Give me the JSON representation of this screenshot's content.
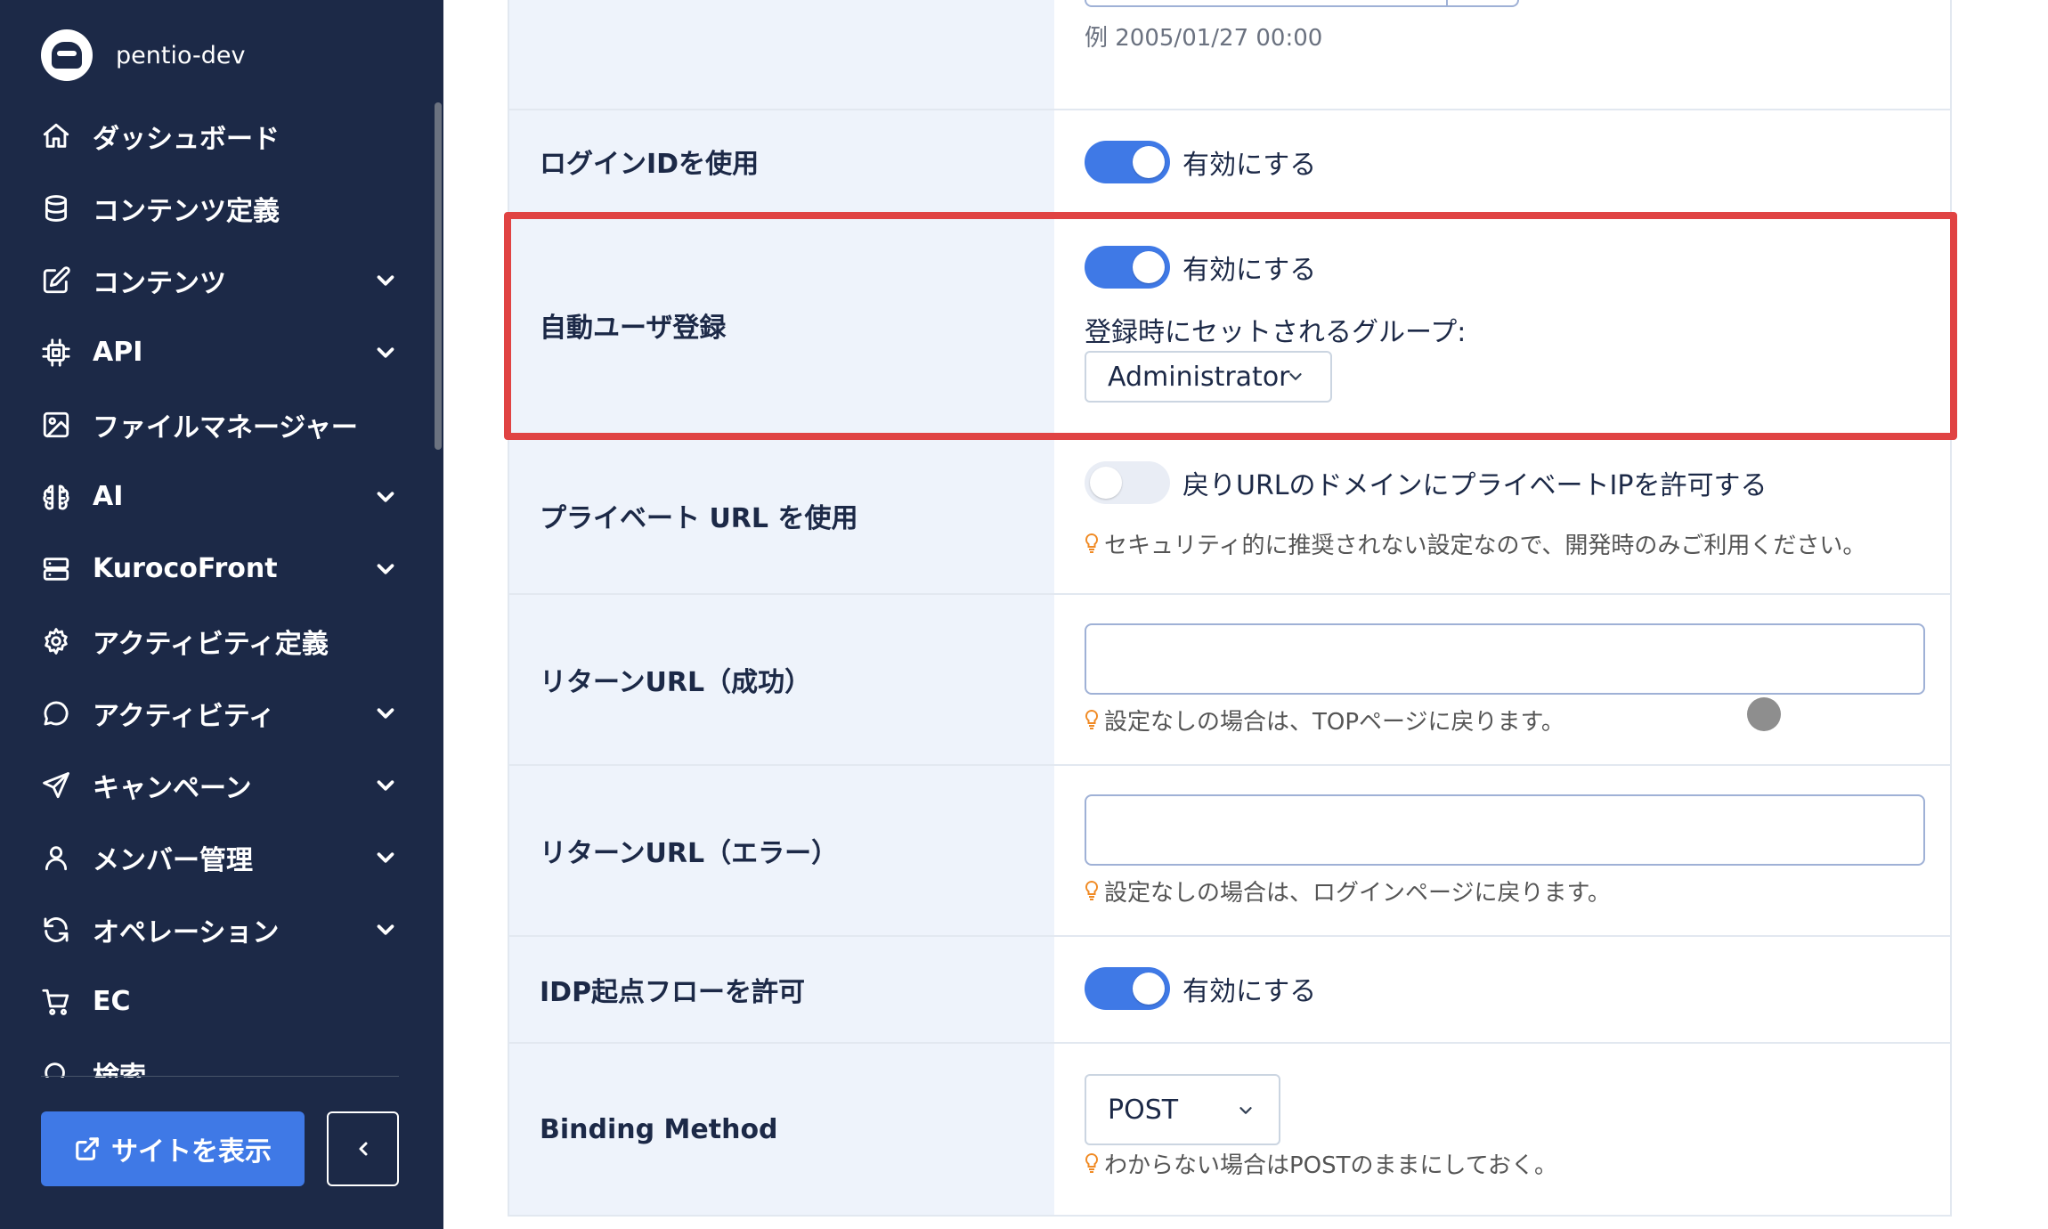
{
  "app": {
    "project_name": "pentio-dev"
  },
  "sidebar": {
    "items": [
      {
        "label": "ダッシュボード",
        "icon": "home-icon",
        "has_submenu": false
      },
      {
        "label": "コンテンツ定義",
        "icon": "database-icon",
        "has_submenu": false
      },
      {
        "label": "コンテンツ",
        "icon": "edit-icon",
        "has_submenu": true
      },
      {
        "label": "API",
        "icon": "chip-icon",
        "has_submenu": true
      },
      {
        "label": "ファイルマネージャー",
        "icon": "image-icon",
        "has_submenu": false
      },
      {
        "label": "AI",
        "icon": "brain-icon",
        "has_submenu": true
      },
      {
        "label": "KurocoFront",
        "icon": "server-icon",
        "has_submenu": true
      },
      {
        "label": "アクティビティ定義",
        "icon": "gear-icon",
        "has_submenu": false
      },
      {
        "label": "アクティビティ",
        "icon": "chat-bubble-icon",
        "has_submenu": true
      },
      {
        "label": "キャンペーン",
        "icon": "send-icon",
        "has_submenu": true
      },
      {
        "label": "メンバー管理",
        "icon": "user-icon",
        "has_submenu": true
      },
      {
        "label": "オペレーション",
        "icon": "refresh-icon",
        "has_submenu": true
      },
      {
        "label": "EC",
        "icon": "cart-icon",
        "has_submenu": false
      },
      {
        "label": "検索",
        "icon": "search-icon",
        "has_submenu": false
      }
    ],
    "view_site_label": "サイトを表示",
    "collapse_icon": "chevron-left-icon"
  },
  "form": {
    "date_row": {
      "hint": "例 2005/01/27 00:00"
    },
    "login_id": {
      "label": "ログインIDを使用",
      "enabled": true,
      "toggle_text": "有効にする"
    },
    "auto_register": {
      "label": "自動ユーザ登録",
      "enabled": true,
      "toggle_text": "有効にする",
      "group_label": "登録時にセットされるグループ:",
      "group_value": "Administrator"
    },
    "private_url": {
      "label": "プライベート URL を使用",
      "enabled": false,
      "toggle_text": "戻りURLのドメインにプライベートIPを許可する",
      "hint": "セキュリティ的に推奨されない設定なので、開発時のみご利用ください。"
    },
    "return_success": {
      "label": "リターンURL（成功）",
      "value": "",
      "hint": "設定なしの場合は、TOPページに戻ります。"
    },
    "return_error": {
      "label": "リターンURL（エラー）",
      "value": "",
      "hint": "設定なしの場合は、ログインページに戻ります。"
    },
    "idp_flow": {
      "label": "IDP起点フローを許可",
      "enabled": true,
      "toggle_text": "有効にする"
    },
    "binding_method": {
      "label": "Binding Method",
      "value": "POST",
      "hint": "わからない場合はPOSTのままにしておく。"
    }
  },
  "colors": {
    "sidebar_bg": "#1c2947",
    "accent": "#3f79e6",
    "label_bg": "#eef3fb",
    "highlight": "#e04343",
    "hint_icon": "#f08a24"
  }
}
